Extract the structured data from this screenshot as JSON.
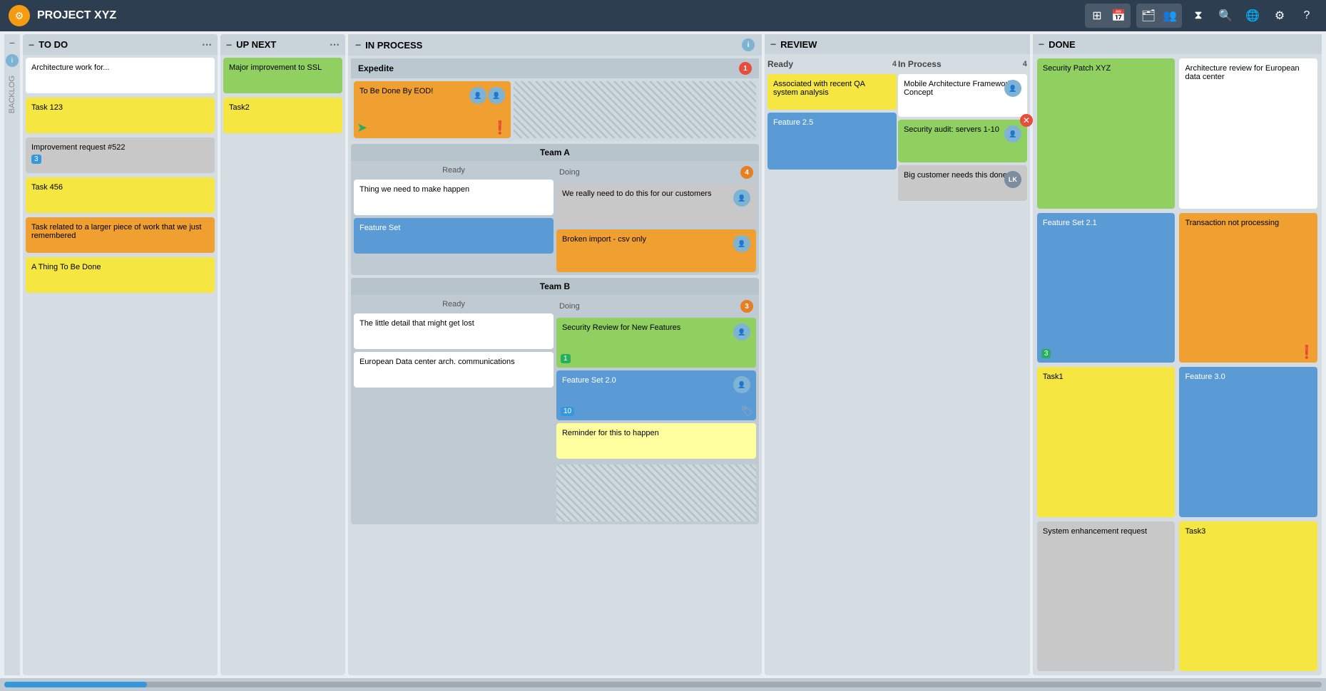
{
  "header": {
    "title": "PROJECT XYZ",
    "logo": "⚙"
  },
  "columns": {
    "todo": {
      "label": "TO DO",
      "cards": [
        {
          "text": "Architecture work for...",
          "color": "white"
        },
        {
          "text": "Task 123",
          "color": "yellow"
        },
        {
          "text": "Improvement request #522",
          "color": "gray",
          "badge": "3"
        },
        {
          "text": "Task 456",
          "color": "yellow"
        },
        {
          "text": "Task related to a larger piece of work that we just remembered",
          "color": "orange"
        },
        {
          "text": "A Thing To Be Done",
          "color": "yellow"
        }
      ]
    },
    "upnext": {
      "label": "UP NEXT",
      "cards": [
        {
          "text": "Major improvement to SSL",
          "color": "green"
        },
        {
          "text": "Task2",
          "color": "yellow"
        }
      ]
    },
    "inprocess": {
      "label": "IN PROCESS",
      "info": true,
      "expedite": {
        "label": "Expedite",
        "count": 1,
        "cards": [
          {
            "text": "To Be Done By EOD!",
            "color": "orange",
            "hasAvatar": true,
            "hasGreenArrow": true,
            "hasPinkExclaim": true
          }
        ]
      },
      "teams": [
        {
          "label": "Team A",
          "ready": {
            "label": "Ready",
            "cards": [
              {
                "text": "Thing we need to make happen",
                "color": "white"
              },
              {
                "text": "Feature Set",
                "color": "blue"
              }
            ]
          },
          "doing": {
            "label": "Doing",
            "count": 4,
            "cards": [
              {
                "text": "We really need to do this for our customers",
                "color": "gray",
                "hasAvatar": true
              },
              {
                "text": "Broken import - csv only",
                "color": "orange",
                "hasAvatar": true
              }
            ]
          }
        },
        {
          "label": "Team B",
          "ready": {
            "label": "Ready",
            "cards": [
              {
                "text": "The little detail that might get lost",
                "color": "white"
              },
              {
                "text": "European Data center arch. communications",
                "color": "white"
              }
            ]
          },
          "doing": {
            "label": "Doing",
            "count": 3,
            "cards": [
              {
                "text": "Security Review for New Features",
                "color": "green",
                "hasAvatar": true,
                "badge": "1"
              },
              {
                "text": "Feature Set 2.0",
                "color": "blue",
                "hasAvatar": true,
                "badge": "10",
                "hasTag": true
              }
            ],
            "extraCards": [
              {
                "text": "Reminder for this to happen",
                "color": "light-yellow"
              }
            ]
          }
        }
      ]
    },
    "review": {
      "label": "REVIEW",
      "ready": {
        "label": "Ready",
        "count": 4,
        "cards": [
          {
            "text": "Associated with recent QA system analysis",
            "color": "yellow"
          },
          {
            "text": "Feature 2.5",
            "color": "blue"
          }
        ]
      },
      "inprocess": {
        "label": "In Process",
        "count": 4,
        "cards": [
          {
            "text": "Mobile Architecture Framework Concept",
            "color": "white",
            "hasAvatar": true
          },
          {
            "text": "Security audit: servers 1-10",
            "color": "green",
            "hasAvatar": true,
            "hasRemove": true
          },
          {
            "text": "Big customer needs this done",
            "color": "gray",
            "badge": "LK"
          }
        ]
      }
    },
    "done": {
      "label": "DONE",
      "cards": [
        {
          "text": "Security Patch XYZ",
          "color": "green"
        },
        {
          "text": "Architecture review for European data center",
          "color": "white"
        },
        {
          "text": "Feature Set 2.1",
          "color": "blue",
          "badge": "3"
        },
        {
          "text": "Transaction not processing",
          "color": "orange",
          "hasOrangeExclaim": true
        },
        {
          "text": "Task1",
          "color": "yellow"
        },
        {
          "text": "Feature 3.0",
          "color": "blue"
        },
        {
          "text": "System enhancement request",
          "color": "gray"
        },
        {
          "text": "Task3",
          "color": "yellow"
        }
      ]
    }
  }
}
